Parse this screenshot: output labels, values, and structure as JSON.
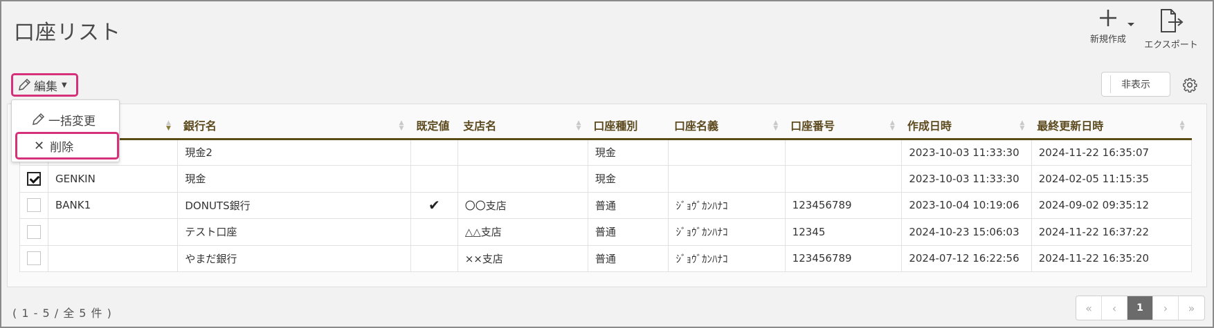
{
  "header": {
    "title": "口座リスト"
  },
  "toolbar": {
    "new_label": "新規作成",
    "export_label": "エクスポート",
    "edit_label": "編集",
    "hide_label": "非表示"
  },
  "edit_menu": {
    "bulk_change": "一括変更",
    "delete": "削除"
  },
  "table": {
    "columns": [
      "",
      "",
      "銀行名",
      "既定値",
      "支店名",
      "口座種別",
      "口座名義",
      "口座番号",
      "作成日時",
      "最終更新日時"
    ],
    "rows": [
      {
        "checked": false,
        "code": "",
        "bank": "現金2",
        "default": "",
        "branch": "",
        "type": "現金",
        "holder": "",
        "number": "",
        "created": "2023-10-03 11:33:30",
        "updated": "2024-11-22 16:35:07"
      },
      {
        "checked": true,
        "code": "GENKIN",
        "bank": "現金",
        "default": "",
        "branch": "",
        "type": "現金",
        "holder": "",
        "number": "",
        "created": "2023-10-03 11:33:30",
        "updated": "2024-02-05 11:15:35"
      },
      {
        "checked": false,
        "code": "BANK1",
        "bank": "DONUTS銀行",
        "default": "✔",
        "branch": "〇〇支店",
        "type": "普通",
        "holder": "ｼﾞｮｳﾞｶﾝﾊﾅｺ",
        "number": "123456789",
        "created": "2023-10-04 10:19:06",
        "updated": "2024-09-02 09:35:12"
      },
      {
        "checked": false,
        "code": "",
        "bank": "テスト口座",
        "default": "",
        "branch": "△△支店",
        "type": "普通",
        "holder": "ｼﾞｮｳﾞｶﾝﾊﾅｺ",
        "number": "12345",
        "created": "2024-10-23 15:06:03",
        "updated": "2024-11-22 16:37:22"
      },
      {
        "checked": false,
        "code": "",
        "bank": "やまだ銀行",
        "default": "",
        "branch": "××支店",
        "type": "普通",
        "holder": "ｼﾞｮｳﾞｶﾝﾊﾅｺ",
        "number": "123456789",
        "created": "2024-07-12 16:22:56",
        "updated": "2024-11-22 16:35:20"
      }
    ]
  },
  "footer": {
    "count": "( 1 - 5 / 全 5 件 )",
    "pager": {
      "first": "«",
      "prev": "‹",
      "current": "1",
      "next": "›",
      "last": "»"
    }
  },
  "colors": {
    "highlight": "#d6307a",
    "header_rule": "#5a4a14",
    "bank_link": "#2e4a78"
  }
}
